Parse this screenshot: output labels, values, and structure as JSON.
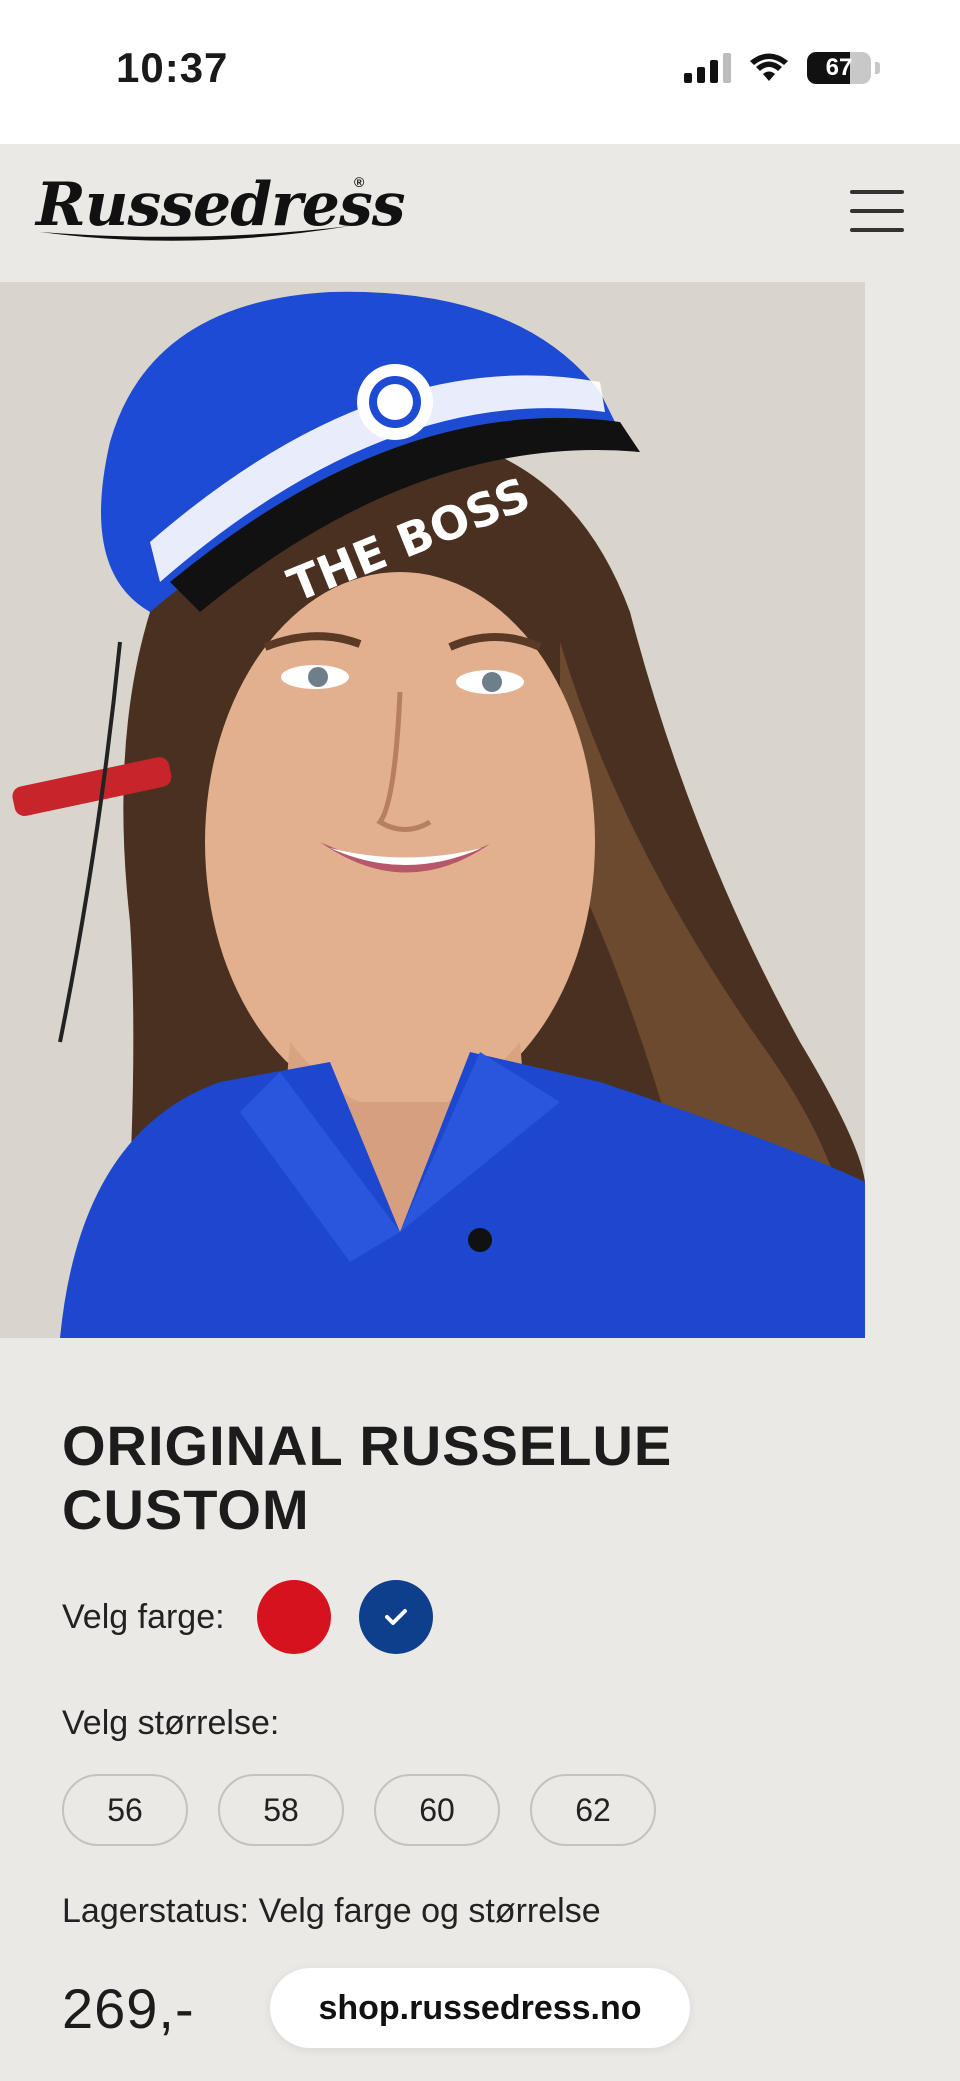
{
  "status_bar": {
    "time": "10:37",
    "battery_level": "67",
    "icons": [
      "signal-icon",
      "wifi-icon",
      "battery-icon"
    ]
  },
  "header": {
    "logo_text": "Russedress",
    "logo_mark": "®",
    "menu_icon": "hamburger-menu-icon"
  },
  "product": {
    "image_cap_text": "THE BOSS",
    "title": "ORIGINAL RUSSELUE CUSTOM",
    "color_label": "Velg farge:",
    "colors": [
      {
        "name": "red",
        "hex": "#d6121f",
        "selected": false
      },
      {
        "name": "blue",
        "hex": "#0e3f8c",
        "selected": true
      }
    ],
    "size_label": "Velg størrelse:",
    "sizes": [
      "56",
      "58",
      "60",
      "62"
    ],
    "stock_status": "Lagerstatus: Velg farge og størrelse",
    "price": "269,-"
  },
  "browser": {
    "url": "shop.russedress.no"
  }
}
